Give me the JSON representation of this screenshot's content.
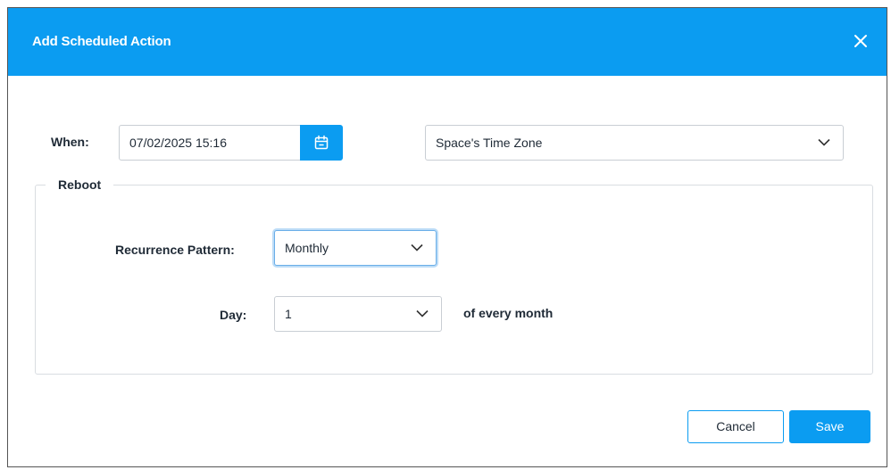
{
  "dialog": {
    "title": "Add Scheduled Action",
    "close_icon": "close-icon"
  },
  "when": {
    "label": "When:",
    "datetime_value": "07/02/2025 15:16",
    "calendar_icon": "calendar-icon",
    "timezone_value": "Space's Time Zone"
  },
  "action": {
    "legend": "Reboot",
    "recurrence_label": "Recurrence Pattern:",
    "recurrence_value": "Monthly",
    "day_label": "Day:",
    "day_value": "1",
    "day_suffix": "of every month"
  },
  "footer": {
    "cancel_label": "Cancel",
    "save_label": "Save"
  },
  "colors": {
    "accent": "#0b9cf1",
    "header_text": "#ffffff"
  }
}
